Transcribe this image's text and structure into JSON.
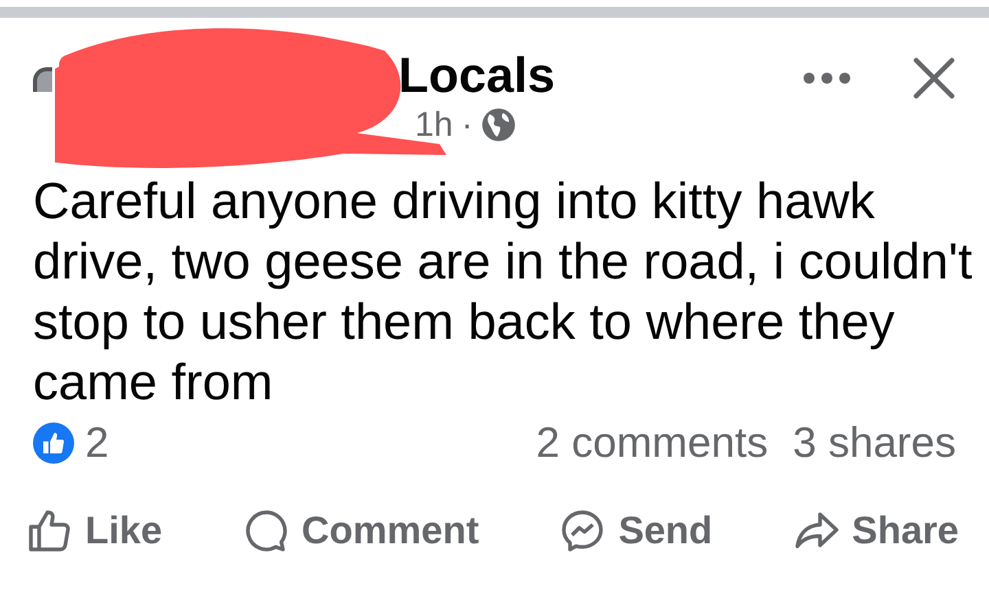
{
  "post": {
    "group_name": "Locals",
    "time": "1h",
    "separator": "·",
    "redacted": true,
    "text": "Careful anyone driving into kitty hawk drive, two geese are in the road, i couldn't stop to usher them back to where they came from",
    "reactions": {
      "count": "2"
    },
    "comments": "2 comments",
    "shares": "3 shares",
    "actions": [
      {
        "kind": "like",
        "label": "Like"
      },
      {
        "kind": "comment",
        "label": "Comment"
      },
      {
        "kind": "send",
        "label": "Send"
      },
      {
        "kind": "share",
        "label": "Share"
      }
    ]
  }
}
